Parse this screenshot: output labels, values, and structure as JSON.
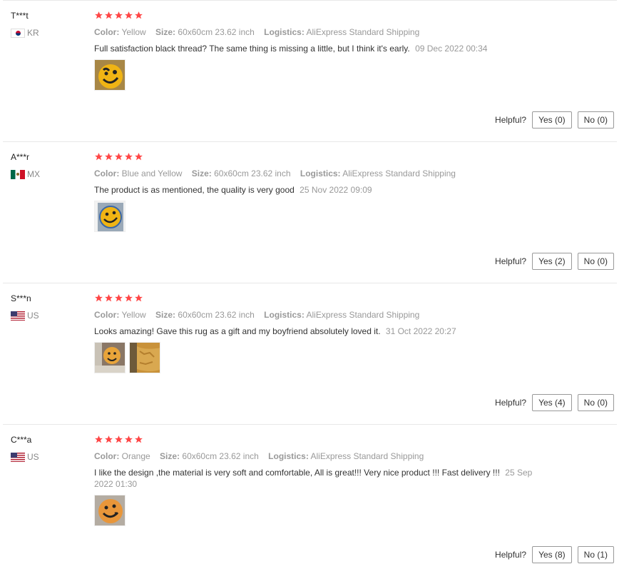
{
  "rating_color": "#ff4747",
  "helpful_label": "Helpful?",
  "reviews": [
    {
      "user": "T***t",
      "country": "KR",
      "flag_icon": "south-korea-flag",
      "stars": 5,
      "color_label": "Color:",
      "color": "Yellow",
      "size_label": "Size:",
      "size": "60x60cm 23.62 inch",
      "logistics_label": "Logistics:",
      "logistics": "AliExpress Standard Shipping",
      "text": "Full satisfaction black thread? The same thing is missing a little, but I think it's early.",
      "date": "09 Dec 2022 00:34",
      "yes": "Yes (0)",
      "no": "No (0)"
    },
    {
      "user": "A***r",
      "country": "MX",
      "flag_icon": "mexico-flag",
      "stars": 5,
      "color_label": "Color:",
      "color": "Blue and Yellow",
      "size_label": "Size:",
      "size": "60x60cm 23.62 inch",
      "logistics_label": "Logistics:",
      "logistics": "AliExpress Standard Shipping",
      "text": "The product is as mentioned, the quality is very good",
      "date": "25 Nov 2022 09:09",
      "yes": "Yes (2)",
      "no": "No (0)"
    },
    {
      "user": "S***n",
      "country": "US",
      "flag_icon": "usa-flag",
      "stars": 5,
      "color_label": "Color:",
      "color": "Yellow",
      "size_label": "Size:",
      "size": "60x60cm 23.62 inch",
      "logistics_label": "Logistics:",
      "logistics": "AliExpress Standard Shipping",
      "text": "Looks amazing! Gave this rug as a gift and my boyfriend absolutely loved it.",
      "date": "31 Oct 2022 20:27",
      "yes": "Yes (4)",
      "no": "No (0)"
    },
    {
      "user": "C***a",
      "country": "US",
      "flag_icon": "usa-flag",
      "stars": 5,
      "color_label": "Color:",
      "color": "Orange",
      "size_label": "Size:",
      "size": "60x60cm 23.62 inch",
      "logistics_label": "Logistics:",
      "logistics": "AliExpress Standard Shipping",
      "text": "I like the design ,the material is very soft and comfortable, All is great!!! Very nice product !!! Fast delivery !!!",
      "date": "25 Sep 2022 01:30",
      "yes": "Yes (8)",
      "no": "No (1)"
    }
  ]
}
